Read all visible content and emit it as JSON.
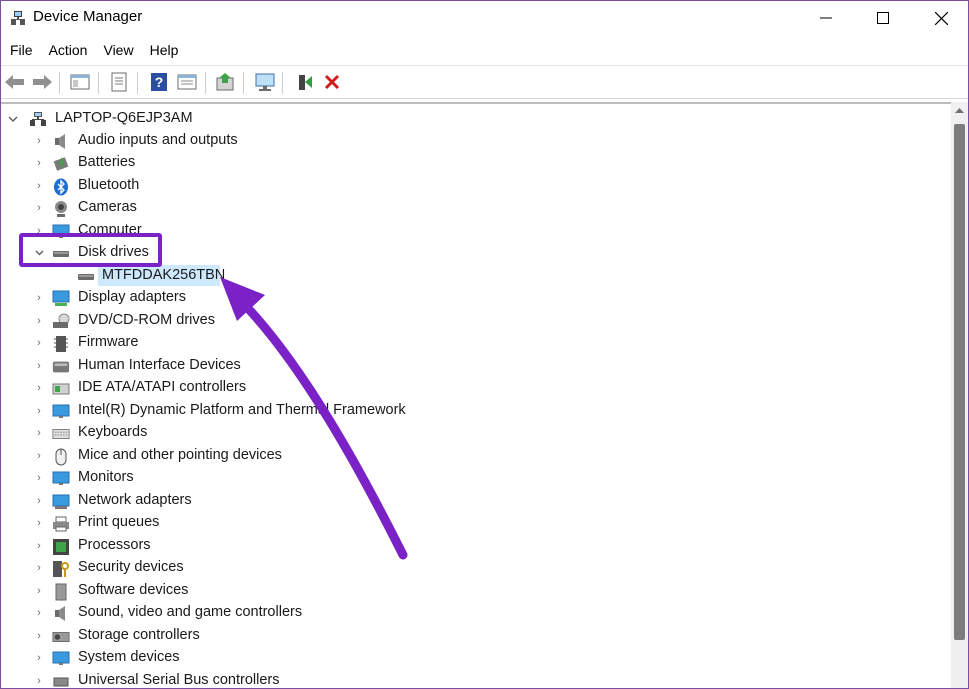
{
  "window": {
    "title": "Device Manager",
    "controls": {
      "minimize": "minimize",
      "maximize": "maximize",
      "close": "close"
    }
  },
  "menu": [
    "File",
    "Action",
    "View",
    "Help"
  ],
  "toolbar": {
    "icons": [
      "back-arrow-icon",
      "forward-arrow-icon",
      "show-hide-console-tree-icon",
      "properties-icon",
      "help-icon",
      "view-icon",
      "update-driver-icon",
      "scan-hardware-icon",
      "enable-device-icon",
      "uninstall-device-icon"
    ]
  },
  "tree": {
    "root": "LAPTOP-Q6EJP3AM",
    "categories": [
      {
        "label": "Audio inputs and outputs",
        "icon": "speaker-icon",
        "expanded": false
      },
      {
        "label": "Batteries",
        "icon": "battery-icon",
        "expanded": false
      },
      {
        "label": "Bluetooth",
        "icon": "bluetooth-icon",
        "expanded": false
      },
      {
        "label": "Cameras",
        "icon": "camera-icon",
        "expanded": false
      },
      {
        "label": "Computer",
        "icon": "monitor-icon",
        "expanded": false
      },
      {
        "label": "Disk drives",
        "icon": "disk-drive-icon",
        "expanded": true
      },
      {
        "label": "Display adapters",
        "icon": "display-adapter-icon",
        "expanded": false
      },
      {
        "label": "DVD/CD-ROM drives",
        "icon": "dvd-drive-icon",
        "expanded": false
      },
      {
        "label": "Firmware",
        "icon": "firmware-icon",
        "expanded": false
      },
      {
        "label": "Human Interface Devices",
        "icon": "hid-icon",
        "expanded": false
      },
      {
        "label": "IDE ATA/ATAPI controllers",
        "icon": "ide-controller-icon",
        "expanded": false
      },
      {
        "label": "Intel(R) Dynamic Platform and Thermal Framework",
        "icon": "intel-platform-icon",
        "expanded": false
      },
      {
        "label": "Keyboards",
        "icon": "keyboard-icon",
        "expanded": false
      },
      {
        "label": "Mice and other pointing devices",
        "icon": "mouse-icon",
        "expanded": false
      },
      {
        "label": "Monitors",
        "icon": "monitor-icon",
        "expanded": false
      },
      {
        "label": "Network adapters",
        "icon": "network-icon",
        "expanded": false
      },
      {
        "label": "Print queues",
        "icon": "printer-icon",
        "expanded": false
      },
      {
        "label": "Processors",
        "icon": "processor-icon",
        "expanded": false
      },
      {
        "label": "Security devices",
        "icon": "security-icon",
        "expanded": false
      },
      {
        "label": "Software devices",
        "icon": "software-device-icon",
        "expanded": false
      },
      {
        "label": "Sound, video and game controllers",
        "icon": "sound-controller-icon",
        "expanded": false
      },
      {
        "label": "Storage controllers",
        "icon": "storage-controller-icon",
        "expanded": false
      },
      {
        "label": "System devices",
        "icon": "system-device-icon",
        "expanded": false
      },
      {
        "label": "Universal Serial Bus controllers",
        "icon": "usb-icon",
        "expanded": false
      }
    ],
    "disk_drive_child": "MTFDDAK256TBN"
  },
  "annotation": {
    "highlight_color": "#7a22c5",
    "arrow_color": "#7a22c5"
  },
  "colors": {
    "selection": "#cde8ff",
    "accent": "#7a22c5"
  }
}
